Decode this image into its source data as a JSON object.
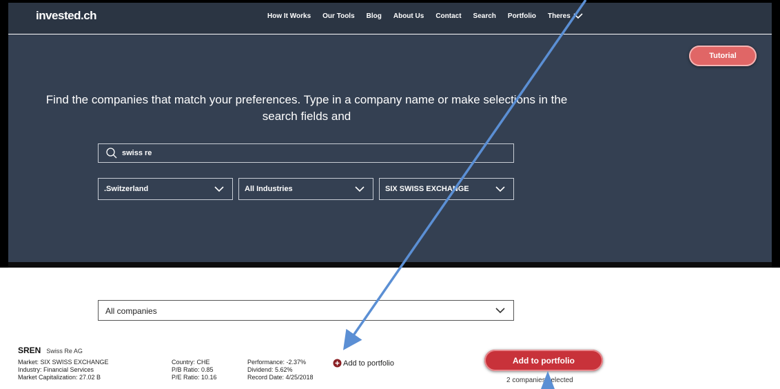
{
  "brand": "invested.ch",
  "nav": {
    "items": [
      "How It Works",
      "Our Tools",
      "Blog",
      "About Us",
      "Contact",
      "Search",
      "Portfolio",
      "Theres"
    ]
  },
  "tutorial_label": "Tutorial",
  "headline": "Find the companies that match your preferences. Type in a company name or make selections in the search fields and",
  "search": {
    "value": "swiss re"
  },
  "filters": {
    "country": ".Switzerland",
    "industry": "All Industries",
    "exchange": "SIX SWISS EXCHANGE"
  },
  "companies_filter": "All companies",
  "result": {
    "ticker": "SREN",
    "name": "Swiss Re AG",
    "market": "Market: SIX SWISS EXCHANGE",
    "industry": "Industry: Financial Services",
    "market_cap": "Market Capitalization: 27.02 B",
    "country": "Country: CHE",
    "pb_ratio": "P/B Ratio: 0.85",
    "pe_ratio": "P/E Ratio: 10.16",
    "performance": "Performance: -2.37%",
    "dividend": "Dividend: 5.62%",
    "record_date": "Record Date: 4/25/2018",
    "add_link": "Add to portfolio"
  },
  "add_button": "Add to portfolio",
  "selected_count": "2 companies selected",
  "colors": {
    "navbar": "#2b3543",
    "hero": "#344052",
    "accent": "#c8323a",
    "tutorial": "#e06666",
    "arrow": "#5b8fd4"
  }
}
